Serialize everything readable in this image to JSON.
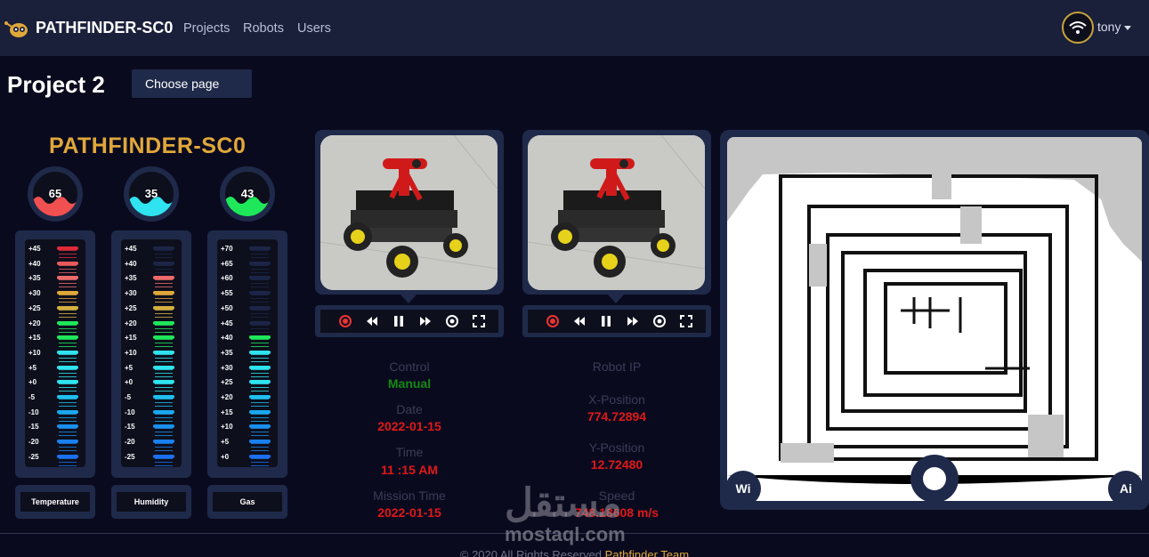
{
  "nav": {
    "brand": "PATHFINDER-SC0",
    "links": [
      "Projects",
      "Robots",
      "Users"
    ],
    "user": "tony"
  },
  "header": {
    "title": "Project 2",
    "choose_page": "Choose page"
  },
  "robot_name": "PATHFINDER-SC0",
  "sensors": [
    {
      "name": "Temperature",
      "value": "65",
      "color": "#f05050",
      "ticks": [
        "+45",
        "+40",
        "+35",
        "+30",
        "+25",
        "+20",
        "+15",
        "+10",
        "+5",
        "+0",
        "-5",
        "-10",
        "-15",
        "-20",
        "-25"
      ]
    },
    {
      "name": "Humidity",
      "value": "35",
      "color": "#2fe3f0",
      "ticks": [
        "+45",
        "+40",
        "+35",
        "+30",
        "+25",
        "+20",
        "+15",
        "+10",
        "+5",
        "+0",
        "-5",
        "-10",
        "-15",
        "-20",
        "-25"
      ]
    },
    {
      "name": "Gas",
      "value": "43",
      "color": "#1ee85a",
      "ticks": [
        "+70",
        "+65",
        "+60",
        "+55",
        "+50",
        "+45",
        "+40",
        "+35",
        "+30",
        "+25",
        "+20",
        "+15",
        "+10",
        "+5",
        "+0"
      ]
    }
  ],
  "info_left": [
    {
      "label": "Control",
      "value": "Manual",
      "color": "#138a13"
    },
    {
      "label": "Date",
      "value": "2022-01-15",
      "color": "#e01818"
    },
    {
      "label": "Time",
      "value": "11 :15 AM",
      "color": "#e01818"
    },
    {
      "label": "Mission Time",
      "value": "2022-01-15",
      "color": "#e01818"
    }
  ],
  "info_right": [
    {
      "label": "Robot IP",
      "value": "",
      "color": "#e01818"
    },
    {
      "label": "X-Position",
      "value": "774.72894",
      "color": "#e01818"
    },
    {
      "label": "Y-Position",
      "value": "12.72480",
      "color": "#e01818"
    },
    {
      "label": "Speed",
      "value": "748.18608 m/s",
      "color": "#e01818"
    }
  ],
  "map": {
    "left_button": "Wi",
    "right_button": "Ai"
  },
  "footer": {
    "text": "© 2020 All Rights Reserved",
    "team": "Pathfinder Team"
  },
  "watermark": {
    "arabic": "مستقل",
    "latin": "mostaql.com"
  }
}
